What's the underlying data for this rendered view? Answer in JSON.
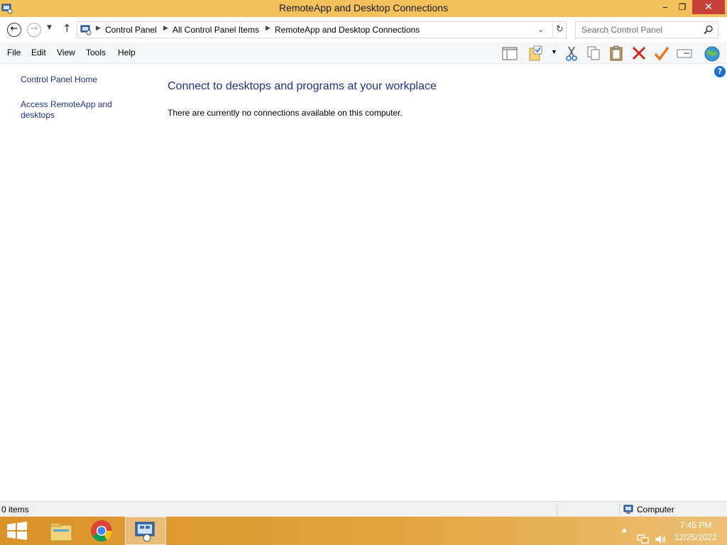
{
  "window": {
    "title": "RemoteApp and Desktop Connections",
    "controls": {
      "minimize": "‒",
      "maximize": "❐",
      "close": "✕"
    }
  },
  "address_bar": {
    "breadcrumbs": [
      "Control Panel",
      "All Control Panel Items",
      "RemoteApp and Desktop Connections"
    ],
    "search_placeholder": "Search Control Panel"
  },
  "menu": {
    "items": [
      "File",
      "Edit",
      "View",
      "Tools",
      "Help"
    ]
  },
  "toolbar": {
    "icons": [
      "layout-icon",
      "folder-options-icon",
      "cut-icon",
      "copy-icon",
      "paste-icon",
      "delete-icon",
      "properties-check-icon",
      "rename-icon",
      "globe-icon"
    ]
  },
  "left_pane": {
    "links": [
      "Control Panel Home",
      "Access RemoteApp and desktops"
    ]
  },
  "content": {
    "heading": "Connect to desktops and programs at your workplace",
    "message": "There are currently no connections available on this computer."
  },
  "status_bar": {
    "item_count": "0 items",
    "zone": "Computer"
  },
  "taskbar": {
    "apps": [
      "start-icon",
      "file-explorer-icon",
      "chrome-icon",
      "control-panel-icon"
    ],
    "time": "7:45 PM",
    "date": "12/25/2022"
  },
  "colors": {
    "title_bar": "#f3c25c",
    "close_button": "#c7413a",
    "link_text": "#1e3287",
    "taskbar": "#e3a43e"
  }
}
